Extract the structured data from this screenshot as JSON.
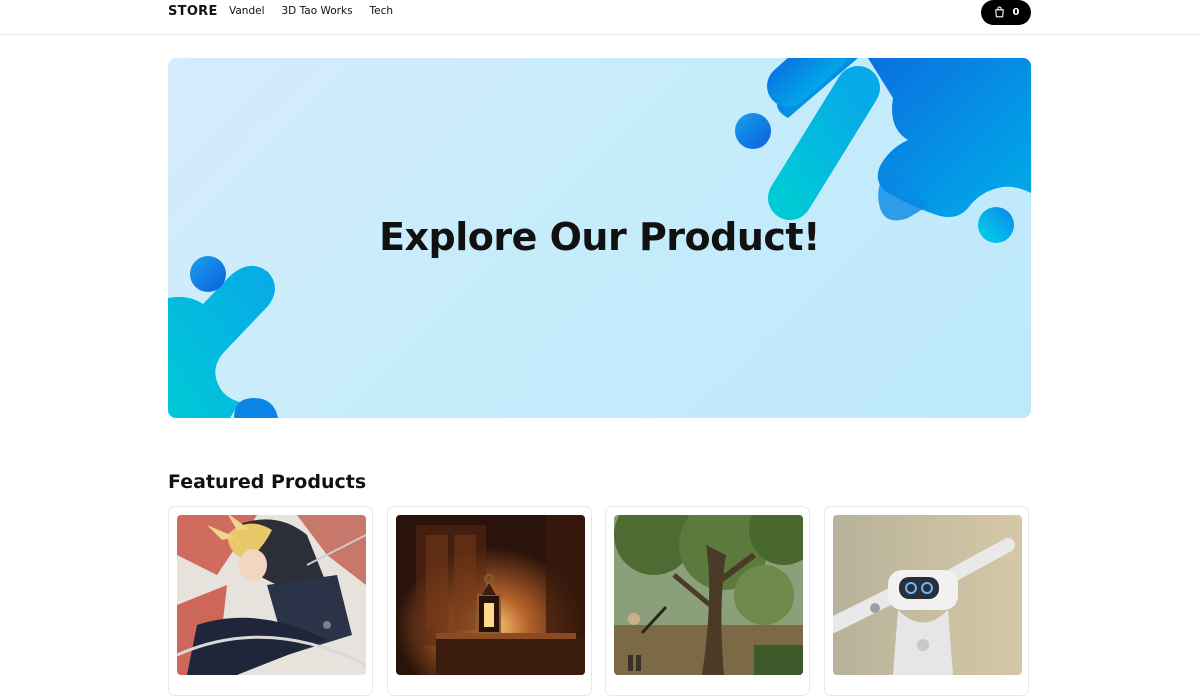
{
  "header": {
    "logo": "STORE",
    "nav": [
      "Vandel",
      "3D Tao Works",
      "Tech"
    ],
    "cart_count": "0",
    "icons": {
      "cart": "shopping-bag-icon"
    }
  },
  "hero": {
    "title": "Explore Our Product!",
    "colors": {
      "bg": "#c6ecfb",
      "blob_cyan": "#00c4d8",
      "blob_blue": "#0a6fe0"
    }
  },
  "featured": {
    "title": "Featured Products",
    "products": [
      {
        "image": "anime-swordsman-illustration"
      },
      {
        "image": "lantern-on-table"
      },
      {
        "image": "soldier-under-tree"
      },
      {
        "image": "white-robot-closeup"
      }
    ]
  }
}
